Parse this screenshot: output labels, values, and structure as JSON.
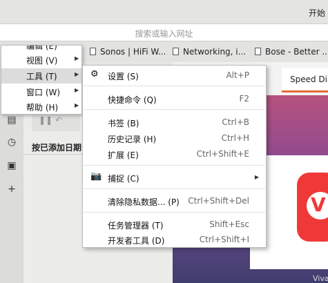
{
  "title_bar": {
    "text": "开始"
  },
  "address_bar": {
    "placeholder": "搜索或输入网址"
  },
  "bookmarks": [
    {
      "label": "Sonos | HiFi W..."
    },
    {
      "label": "Networking, i..."
    },
    {
      "label": "Bose - Better ..."
    }
  ],
  "panel": {
    "sort_label": "按已添加日期"
  },
  "speed_dial_tab": {
    "label": "Speed Dia"
  },
  "hero": {
    "logo_letter": "V",
    "label": "Viva"
  },
  "main_menu": {
    "partial_item": "编辑 (E)",
    "items": [
      {
        "label": "视图 (V)",
        "has_submenu": true
      },
      {
        "label": "工具 (T)",
        "has_submenu": true,
        "active": true
      },
      {
        "label": "窗口 (W)",
        "has_submenu": true
      },
      {
        "label": "帮助 (H)",
        "has_submenu": true
      }
    ]
  },
  "tools_menu": {
    "items": [
      {
        "icon": "gear-icon",
        "label": "设置 (S)",
        "shortcut": "Alt+P"
      },
      {
        "label": "快捷命令 (Q)",
        "shortcut": "F2"
      },
      {
        "label": "书签 (B)",
        "shortcut": "Ctrl+B"
      },
      {
        "label": "历史记录 (H)",
        "shortcut": "Ctrl+H"
      },
      {
        "label": "扩展 (E)",
        "shortcut": "Ctrl+Shift+E"
      },
      {
        "icon": "camera-icon",
        "label": "捕捉 (C)",
        "shortcut": "",
        "has_submenu": true
      },
      {
        "label": "清除隐私数据... (P)",
        "shortcut": "Ctrl+Shift+Del"
      },
      {
        "label": "任务管理器 (T)",
        "shortcut": "Shift+Esc"
      },
      {
        "label": "开发者工具 (D)",
        "shortcut": "Ctrl+Shift+I"
      }
    ]
  },
  "colors": {
    "accent": "#e56a3b",
    "vivaldi_red": "#ef3939",
    "menu_highlight": "#dcdcdc"
  }
}
